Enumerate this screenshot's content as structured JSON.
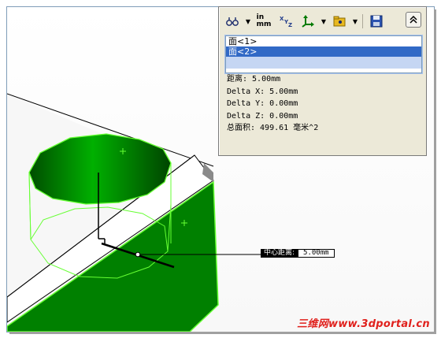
{
  "toolbar": {
    "tools": [
      {
        "icon": "glasses-icon",
        "label": "&#x26AF;"
      },
      {
        "icon": "units-icon",
        "line1": "in",
        "line2": "mm"
      },
      {
        "icon": "xyz-axis-icon",
        "label": "XYZ"
      },
      {
        "icon": "triad-icon"
      },
      {
        "icon": "folder-icon"
      },
      {
        "icon": "save-icon"
      }
    ]
  },
  "selection_list": {
    "items": [
      {
        "label": "面<1>",
        "selected": false
      },
      {
        "label": "面<2>",
        "selected": true
      }
    ]
  },
  "results": {
    "distance": "距离: 5.00mm",
    "delta_x": "Delta X: 5.00mm",
    "delta_y": "Delta Y: 0.00mm",
    "delta_z": "Delta Z: 0.00mm",
    "total_area": "总面积: 499.61 毫米^2"
  },
  "callout": {
    "label": "中心距离:",
    "value": "5.00mm"
  },
  "watermark": "三维网www.3dportal.cn",
  "colors": {
    "panel_bg": "#ece9d8",
    "selection": "#3169c6",
    "model_green": "#008000",
    "highlight_green": "#66ff33",
    "watermark_red": "#e0201c"
  }
}
